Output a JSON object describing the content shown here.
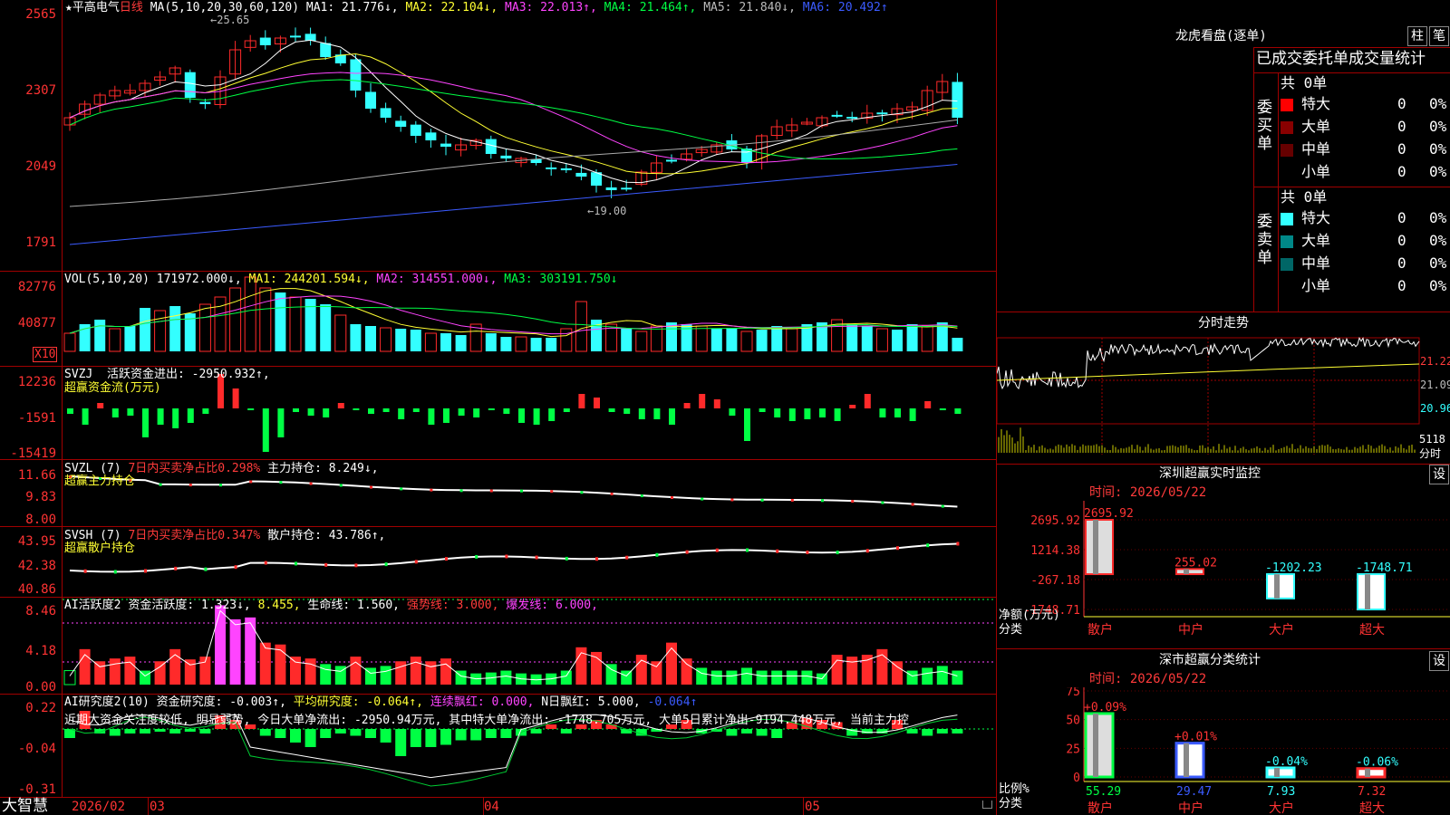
{
  "app": {
    "brand": "大智慧",
    "stock_name": "平高电气",
    "period": "日线"
  },
  "colors": {
    "up": "#ff2a2a",
    "down": "#33ffff",
    "grid": "#a00000",
    "axis_text": "#ff3333"
  },
  "main_chart": {
    "ma_label": "MA(5,10,20,30,60,120)",
    "ma1": "MA1: 21.776↓,",
    "ma2": "MA2: 22.104↓,",
    "ma3": "MA3: 22.013↑,",
    "ma4": "MA4: 21.464↑,",
    "ma5": "MA5: 21.840↓,",
    "ma6": "MA6: 20.492↑",
    "y_ticks": [
      "2565",
      "2307",
      "2049",
      "1791"
    ],
    "high_label": "25.65",
    "low_label": "19.00"
  },
  "vol_panel": {
    "label": "VOL(5,10,20)",
    "value": "171972.000↓,",
    "ma1": "MA1: 244201.594↓,",
    "ma2": "MA2: 314551.000↓,",
    "ma3": "MA3: 303191.750↓",
    "y_ticks": [
      "82776",
      "40877"
    ],
    "unit": "X10"
  },
  "svzj_panel": {
    "label": "SVZJ",
    "desc": "活跃资金进出: -2950.932↑,",
    "sub": "超赢资金流(万元)",
    "y_ticks": [
      "12236",
      "-1591",
      "-15419"
    ]
  },
  "svzl_panel": {
    "label": "SVZL (7)",
    "desc": "7日内买卖净占比0.298%",
    "value": "主力持仓: 8.249↓,",
    "sub": "超赢主力持仓",
    "y_ticks": [
      "11.66",
      "9.83",
      "8.00"
    ]
  },
  "svsh_panel": {
    "label": "SVSH (7)",
    "desc": "7日内买卖净占比0.347%",
    "value": "散户持仓: 43.786↑,",
    "sub": "超赢散户持仓",
    "y_ticks": [
      "43.95",
      "42.38",
      "40.86"
    ]
  },
  "ai_panel": {
    "label": "AI活跃度2",
    "v1": "资金活跃度: 1.323↓,",
    "v2": "8.455,",
    "v3": "生命线: 1.560,",
    "v4": "强势线: 3.000,",
    "v5": "爆发线: 6.000,",
    "y_ticks": [
      "8.46",
      "4.18",
      "0.00"
    ]
  },
  "ai2_panel": {
    "label": "AI研究度2(10)",
    "v1": "资金研究度: -0.003↑,",
    "v2": "平均研究度: -0.064↑,",
    "v3": "连续飘红: 0.000,",
    "v4": "N日飘红: 5.000,",
    "v5": "-0.064↑",
    "desc": "近期大资金关注度较低, 明显弱势, 今日大单净流出: -2950.94万元, 其中特大单净流出: -1748.705万元, 大单5日累计净出-9194.448万元, 当前主力控",
    "y_ticks": [
      "0.22",
      "-0.04",
      "-0.31"
    ]
  },
  "x_axis": {
    "labels": [
      "2026/02",
      "03",
      "04",
      "05"
    ]
  },
  "longhu": {
    "title": "龙虎看盘(逐单)",
    "btn_bar": "柱",
    "btn_pen": "笔",
    "header": "已成交委托单成交量统计",
    "buy_group": "委买单",
    "sell_group": "委卖单",
    "buy_total": "共 0单",
    "sell_total": "共 0单",
    "buy_rows": [
      {
        "label": "特大",
        "count": "0",
        "pct": "0%",
        "color": "#ff0000"
      },
      {
        "label": "大单",
        "count": "0",
        "pct": "0%",
        "color": "#880000"
      },
      {
        "label": "中单",
        "count": "0",
        "pct": "0%",
        "color": "#660000"
      },
      {
        "label": "小单",
        "count": "0",
        "pct": "0%",
        "color": "#000000"
      }
    ],
    "sell_rows": [
      {
        "label": "特大",
        "count": "0",
        "pct": "0%",
        "color": "#33ffff"
      },
      {
        "label": "大单",
        "count": "0",
        "pct": "0%",
        "color": "#008888"
      },
      {
        "label": "中单",
        "count": "0",
        "pct": "0%",
        "color": "#006666"
      },
      {
        "label": "小单",
        "count": "0",
        "pct": "0%",
        "color": "#000000"
      }
    ]
  },
  "intraday": {
    "title": "分时走势",
    "y_ticks": [
      "21.22",
      "21.09",
      "20.96"
    ],
    "vol_label": "5118",
    "vol_unit": "分时"
  },
  "sz_monitor": {
    "title": "深圳超赢实时监控",
    "btn": "设",
    "time": "时间: 2026/05/22",
    "y_ticks": [
      "2695.92",
      "1214.38",
      "-267.18",
      "-1748.71"
    ],
    "y_title": "净额(万元)",
    "x_title": "分类",
    "bars": [
      {
        "label": "散户",
        "value": 2695.92,
        "text": "2695.92"
      },
      {
        "label": "中户",
        "value": 255.02,
        "text": "255.02"
      },
      {
        "label": "大户",
        "value": -1202.23,
        "text": "-1202.23"
      },
      {
        "label": "超大",
        "value": -1748.71,
        "text": "-1748.71"
      }
    ]
  },
  "sh_stats": {
    "title": "深市超赢分类统计",
    "btn": "设",
    "time": "时间: 2026/05/22",
    "y_ticks": [
      "75",
      "50",
      "25",
      "0"
    ],
    "y_title": "比例%",
    "x_title": "分类",
    "bars": [
      {
        "label": "散户",
        "value": 55.29,
        "text": "55.29",
        "delta": "+0.09%"
      },
      {
        "label": "中户",
        "value": 29.47,
        "text": "29.47",
        "delta": "+0.01%"
      },
      {
        "label": "大户",
        "value": 7.93,
        "text": "7.93",
        "delta": "-0.04%"
      },
      {
        "label": "超大",
        "value": 7.32,
        "text": "7.32",
        "delta": "-0.06%"
      }
    ]
  }
}
